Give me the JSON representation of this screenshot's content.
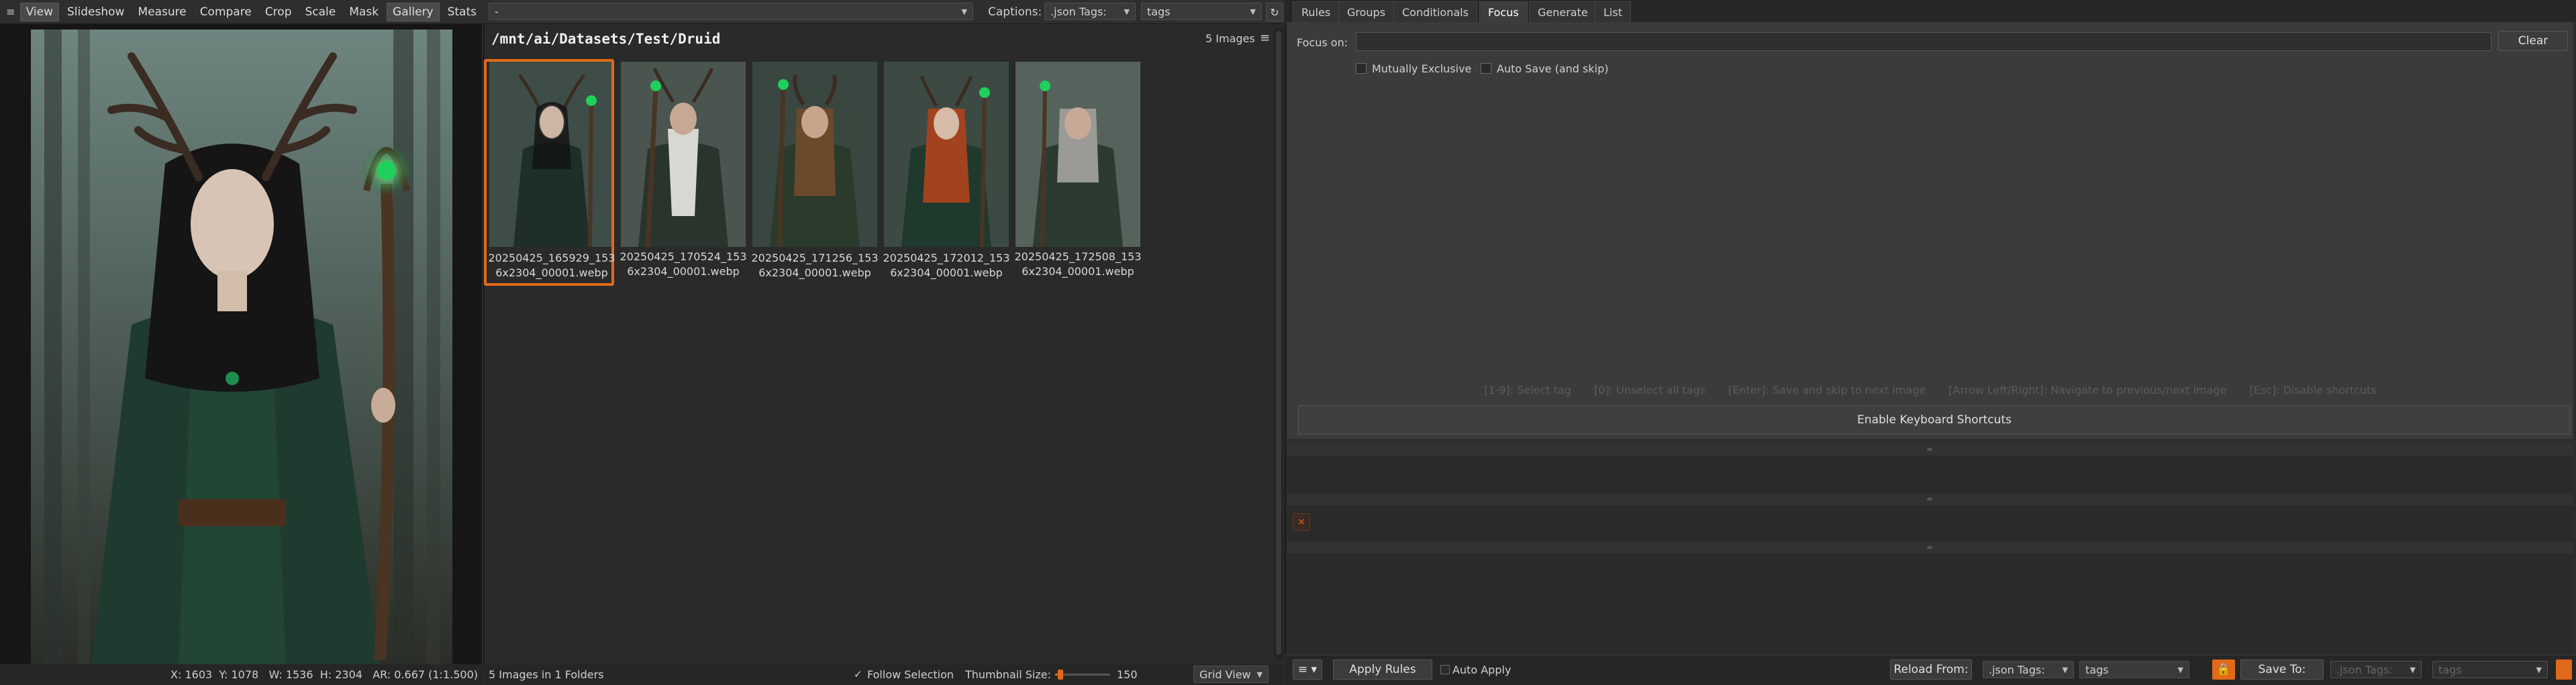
{
  "viewer": {
    "tabs": [
      "View",
      "Slideshow",
      "Measure",
      "Compare",
      "Crop",
      "Scale",
      "Mask",
      "Gallery",
      "Stats"
    ],
    "status": "X: 1603  Y: 1078   W: 1536  H: 2304   AR: 0.667 (1:1.500)"
  },
  "gallery": {
    "path_combo": "-",
    "captions_label": "Captions:",
    "captions_source": ".json Tags:",
    "captions_key": "tags",
    "folder": "/mnt/ai/Datasets/Test/Druid",
    "count": "5 Images",
    "thumbs": [
      {
        "l1": "20250425_165929_153",
        "l2": "6x2304_00001.webp"
      },
      {
        "l1": "20250425_170524_153",
        "l2": "6x2304_00001.webp"
      },
      {
        "l1": "20250425_171256_153",
        "l2": "6x2304_00001.webp"
      },
      {
        "l1": "20250425_172012_153",
        "l2": "6x2304_00001.webp"
      },
      {
        "l1": "20250425_172508_153",
        "l2": "6x2304_00001.webp"
      }
    ],
    "status": "5 Images in 1 Folders",
    "follow_selection": "Follow Selection",
    "thumb_size_label": "Thumbnail Size:",
    "thumb_size_value": "150",
    "thumb_size_fraction": 0.1,
    "view_mode": "Grid View"
  },
  "rules": {
    "tabs": [
      "Rules",
      "Groups",
      "Conditionals",
      "Focus",
      "Generate",
      "List"
    ],
    "active_tab": "Focus",
    "focus_on_label": "Focus on:",
    "clear": "Clear",
    "mutually_exclusive": "Mutually Exclusive",
    "auto_save": "Auto Save (and skip)",
    "hints": [
      "[1-9]: Select tag",
      "[0]: Unselect all tags",
      "[Enter]: Save and skip to next image",
      "[Arrow Left/Right]: Navigate to previous/next image",
      "[Esc]: Disable shortcuts"
    ],
    "enable_shortcuts": "Enable Keyboard Shortcuts",
    "apply_rules": "Apply Rules",
    "auto_apply": "Auto Apply",
    "reload_from": "Reload From:",
    "reload_source": ".json Tags:",
    "reload_key": "tags",
    "save_to": "Save To:",
    "save_source": ".json Tags:",
    "save_key": "tags"
  },
  "colors": {
    "accent": "#e06a1a",
    "panel": "#2b2b2b"
  }
}
